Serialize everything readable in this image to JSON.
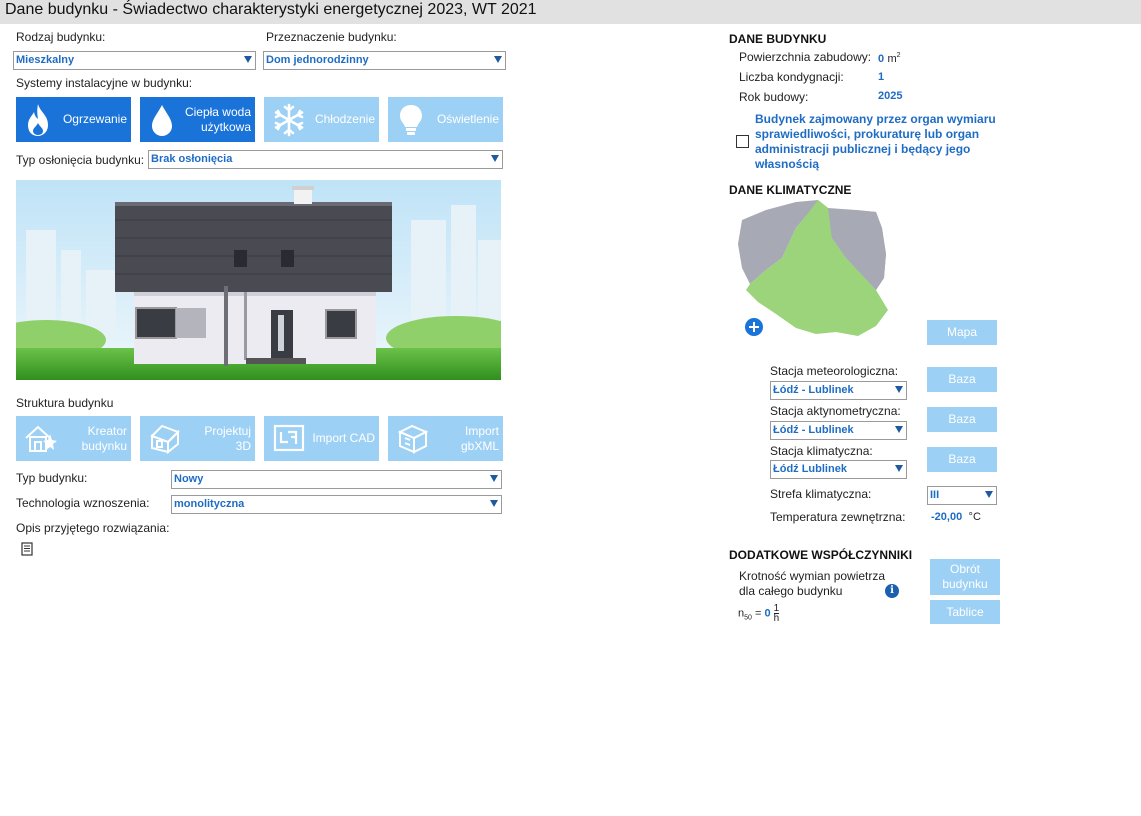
{
  "window": {
    "title": "Dane budynku - Świadectwo charakterystyki energetycznej 2023, WT 2021"
  },
  "left": {
    "rodzaj_label": "Rodzaj budynku:",
    "rodzaj_value": "Mieszkalny",
    "przeznaczenie_label": "Przeznaczenie budynku:",
    "przeznaczenie_value": "Dom jednorodzinny",
    "systemy_label": "Systemy instalacyjne w budynku:",
    "systems": [
      {
        "label": "Ogrzewanie",
        "active": true,
        "icon": "flame-icon"
      },
      {
        "label": "Ciepła woda użytkowa",
        "label_l1": "Ciepła woda",
        "label_l2": "użytkowa",
        "active": true,
        "icon": "water-drop-icon"
      },
      {
        "label": "Chłodzenie",
        "active": false,
        "icon": "snowflake-icon"
      },
      {
        "label": "Oświetlenie",
        "active": false,
        "icon": "lightbulb-icon"
      }
    ],
    "oslona_label": "Typ osłonięcia budynku:",
    "oslona_value": "Brak osłonięcia",
    "struktura_label": "Struktura budynku",
    "struktura_buttons": [
      {
        "label_l1": "Kreator",
        "label_l2": "budynku",
        "icon": "house-wizard-icon"
      },
      {
        "label_l1": "Projektuj",
        "label_l2": "3D",
        "icon": "house-3d-icon"
      },
      {
        "label_l1": "Import CAD",
        "label_l2": "",
        "icon": "cad-plan-icon"
      },
      {
        "label_l1": "Import",
        "label_l2": "gbXML",
        "icon": "gbxml-cube-icon"
      }
    ],
    "typ_label": "Typ budynku:",
    "typ_value": "Nowy",
    "technologia_label": "Technologia wznoszenia:",
    "technologia_value": "monolityczna",
    "opis_label": "Opis przyjętego rozwiązania:"
  },
  "right": {
    "dane_budynku_title": "DANE BUDYNKU",
    "powierzchnia_label": "Powierzchnia zabudowy:",
    "powierzchnia_value": "0",
    "powierzchnia_unit": "m",
    "powierzchnia_unit_sup": "2",
    "kondygnacje_label": "Liczba kondygnacji:",
    "kondygnacje_value": "1",
    "rok_label": "Rok budowy:",
    "rok_value": "2025",
    "checkbox_label_lines": [
      "Budynek zajmowany przez organ wymiaru",
      "sprawiedliwości, prokuraturę lub organ",
      "administracji publicznej i będący jego",
      "własnością"
    ],
    "checkbox_checked": false,
    "dane_klimatyczne_title": "DANE KLIMATYCZNE",
    "mapa_button": "Mapa",
    "stacja_met_label": "Stacja meteorologiczna:",
    "stacja_met_value": "Łódź - Lublinek",
    "stacja_akt_label": "Stacja aktynometryczna:",
    "stacja_akt_value": "Łódź - Lublinek",
    "stacja_klim_label": "Stacja klimatyczna:",
    "stacja_klim_value": "Łódź Lublinek",
    "baza_button": "Baza",
    "strefa_label": "Strefa klimatyczna:",
    "strefa_value": "III",
    "temp_label": "Temperatura zewnętrzna:",
    "temp_value": "-20,00",
    "temp_unit": "°C",
    "dodatkowe_title": "DODATKOWE WSPÓŁCZYNNIKI",
    "krotnosc_l1": "Krotność wymian powietrza",
    "krotnosc_l2": "dla całego budynku",
    "obrot_l1": "Obrót",
    "obrot_l2": "budynku",
    "tablice_button": "Tablice",
    "n50_symbol": "n",
    "n50_sub": "50",
    "n50_eq": "=",
    "n50_value": "0",
    "n50_num": "1",
    "n50_den": "h"
  },
  "colors": {
    "accent_active": "#1a73d9",
    "accent_inactive": "#9dd0f5",
    "value_blue": "#1f6cc4",
    "map_green": "#9bd47a",
    "map_gray": "#a7a9b4"
  }
}
